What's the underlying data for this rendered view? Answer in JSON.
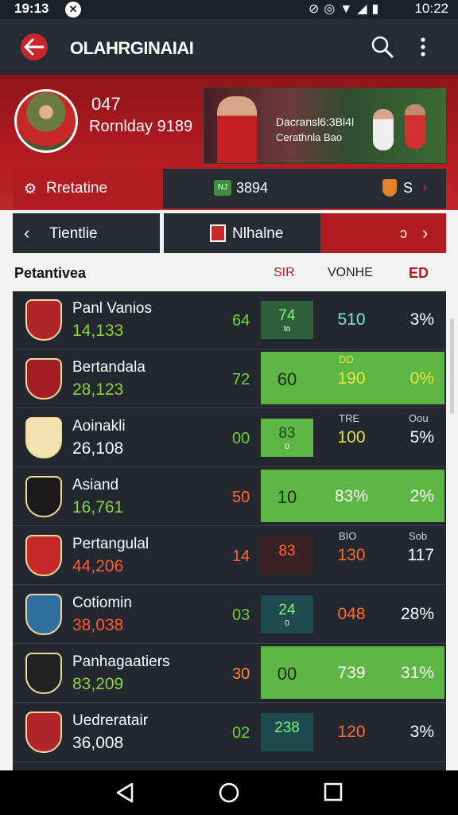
{
  "status_bar": {
    "time": "19:13",
    "time_right": "10:22",
    "notif_icon": "x-icon",
    "icons": [
      "mute-icon",
      "alarm-icon",
      "wifi-icon",
      "signal-icon",
      "battery-icon"
    ]
  },
  "app_bar": {
    "title": "OLAHRGINAIAI",
    "back_icon": "back-arrow-icon",
    "search_icon": "search-icon",
    "more_icon": "more-vert-icon",
    "accent": "#c7262b"
  },
  "hero": {
    "number": "047",
    "subtitle": "Rornlday 9189",
    "banner": {
      "line1": "Dacransl6:3Bl4l",
      "line2": "Cerathnla Bao"
    }
  },
  "tabs_top": {
    "profile_label": "Rretatine",
    "mid_label": "3894",
    "mid_badge": "NJ",
    "right_label": "S"
  },
  "tabs_second": {
    "left_label": "Tientlie",
    "mid_label": "Nlhalne",
    "right_label": "ɔ"
  },
  "columns": {
    "name": "Petantivea",
    "sr": "SIR",
    "volume": "VONHE",
    "e": "ED"
  },
  "rows": [
    {
      "name": "Panl Vanios",
      "value": "14,133",
      "value_color": "#8bd33a",
      "rank": "64",
      "rank_color": "#6cd33a",
      "box_top": "74",
      "box_bot": "to",
      "box_style": "dark-green",
      "volume": "510",
      "volume_color": "#7fe0e0",
      "e": "3%",
      "e_color": "#ffffff"
    },
    {
      "name": "Bertandala",
      "value": "28,123",
      "value_color": "#8bd33a",
      "rank": "72",
      "rank_color": "#6cd33a",
      "box_top": "60",
      "box_bot": "",
      "box_style": "wide",
      "volume": "190",
      "volume_color": "#e3e63a",
      "e": "0%",
      "e_color": "#e3e63a",
      "small_vol": "DD"
    },
    {
      "name": "Aoinakli",
      "value": "26,108",
      "value_color": "#ffffff",
      "rank": "00",
      "rank_color": "#6cd33a",
      "box_top": "83",
      "box_bot": "0",
      "box_style": "bright-green",
      "volume": "100",
      "volume_color": "#e3e63a",
      "e": "5%",
      "e_color": "#ffffff",
      "small_vol": "TRE",
      "small_e": "Oou"
    },
    {
      "name": "Asiand",
      "value": "16,761",
      "value_color": "#8bd33a",
      "rank": "50",
      "rank_color": "#ff6a2a",
      "box_top": "10",
      "box_bot": "",
      "box_style": "wide",
      "volume": "83%",
      "volume_color": "#ffffff",
      "e": "2%",
      "e_color": "#ffffff"
    },
    {
      "name": "Pertangulal",
      "value": "44,206",
      "value_color": "#ff5a2a",
      "rank": "14",
      "rank_color": "#ff6a2a",
      "box_top": "83",
      "box_bot": "",
      "box_style": "dark-red",
      "volume": "130",
      "volume_color": "#ff6a2a",
      "e": "117",
      "e_color": "#ffffff",
      "small_vol": "BIO",
      "small_e": "Sob"
    },
    {
      "name": "Cotiomin",
      "value": "38,038",
      "value_color": "#ff5a2a",
      "rank": "03",
      "rank_color": "#6cd33a",
      "box_top": "24",
      "box_bot": "0",
      "box_style": "teal",
      "volume": "048",
      "volume_color": "#ff6a2a",
      "e": "28%",
      "e_color": "#ffffff"
    },
    {
      "name": "Panhagaatiers",
      "value": "83,209",
      "value_color": "#8bd33a",
      "rank": "30",
      "rank_color": "#ff8a2a",
      "box_top": "00",
      "box_bot": "",
      "box_style": "wide",
      "volume": "739",
      "volume_color": "#ffffff",
      "e": "31%",
      "e_color": "#ffffff"
    },
    {
      "name": "Uedreratair",
      "value": "36,008",
      "value_color": "#ffffff",
      "rank": "02",
      "rank_color": "#6cd33a",
      "box_top": "238",
      "box_bot": "",
      "box_style": "teal",
      "volume": "120",
      "volume_color": "#ff6a2a",
      "e": "3%",
      "e_color": "#ffffff"
    }
  ],
  "nav_bar": {
    "back": "nav-back-icon",
    "home": "nav-home-icon",
    "recents": "nav-recents-icon"
  }
}
